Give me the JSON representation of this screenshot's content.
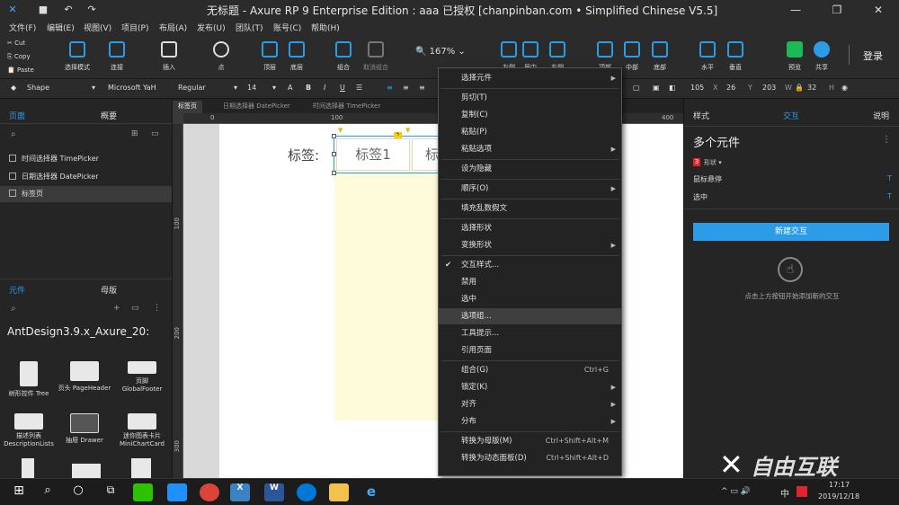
{
  "title": "无标题 - Axure RP 9 Enterprise Edition : aaa 已授权   [chanpinban.com • Simplified Chinese V5.5]",
  "window_controls": [
    "—",
    "❐",
    "✕"
  ],
  "menu": [
    "文件(F)",
    "编辑(E)",
    "视图(V)",
    "项目(P)",
    "布局(A)",
    "发布(U)",
    "团队(T)",
    "账号(C)",
    "帮助(H)"
  ],
  "clipboard": {
    "cut": "Cut",
    "copy": "Copy",
    "paste": "Paste"
  },
  "toolbar": {
    "select_mode": "选择模式",
    "connect": "连接",
    "insert": "插入",
    "point": "点",
    "top": "顶层",
    "bottom": "底层",
    "group": "组合",
    "ungroup": "取消组合",
    "zoom": "167%",
    "left": "左侧",
    "center": "居中",
    "right": "右侧",
    "top_align": "顶部",
    "middle": "中部",
    "bottom_align": "底部",
    "horizontal": "水平",
    "vertical": "垂直",
    "preview": "预览",
    "share": "共享",
    "login": "登录"
  },
  "format": {
    "shape": "Shape",
    "font": "Microsoft YaH",
    "weight": "Regular",
    "size": "14",
    "x": "105",
    "x_label": "X",
    "y": "26",
    "y_label": "Y",
    "w": "203",
    "w_label": "W",
    "h": "32",
    "h_label": "H"
  },
  "left_panel": {
    "tab_pages": "页面",
    "tab_outline": "概要",
    "pages": [
      "时间选择器 TimePicker",
      "日期选择器 DatePicker",
      "标签页"
    ],
    "tab_widgets": "元件",
    "tab_masters": "母版",
    "library": "AntDesign3.9.x_Axure_20:",
    "library_items": [
      {
        "name": "树形控件 Tree"
      },
      {
        "name": "页头 PageHeader"
      },
      {
        "name": "页脚 GlobalFooter"
      },
      {
        "name": "描述列表 DescriptionLists"
      },
      {
        "name": "抽屉 Drawer"
      },
      {
        "name": "迷你图表卡片 MiniChartCard"
      }
    ]
  },
  "doc_tabs": [
    "标签页",
    "日期选择器 DatePicker",
    "时间选择器 TimePicker"
  ],
  "ruler_h": [
    "0",
    "100",
    "400"
  ],
  "ruler_v": [
    "100",
    "200",
    "300"
  ],
  "canvas": {
    "label": "标签:",
    "tab1": "标签1",
    "tab2": "标"
  },
  "context_menu": [
    {
      "label": "选择元件",
      "arrow": "▶"
    },
    {
      "sep": true
    },
    {
      "label": "剪切(T)"
    },
    {
      "label": "复制(C)"
    },
    {
      "label": "粘贴(P)"
    },
    {
      "label": "粘贴选项",
      "arrow": "▶"
    },
    {
      "sep": true
    },
    {
      "label": "设为隐藏"
    },
    {
      "sep": true
    },
    {
      "label": "顺序(O)",
      "arrow": "▶"
    },
    {
      "sep": true
    },
    {
      "label": "填充乱数假文"
    },
    {
      "sep": true
    },
    {
      "label": "选择形状"
    },
    {
      "label": "变换形状",
      "arrow": "▶"
    },
    {
      "sep": true
    },
    {
      "label": "交互样式...",
      "check": "✔"
    },
    {
      "label": "禁用"
    },
    {
      "label": "选中"
    },
    {
      "label": "选项组...",
      "highlight": true
    },
    {
      "label": "工具提示..."
    },
    {
      "label": "引用页面"
    },
    {
      "sep": true
    },
    {
      "label": "组合(G)",
      "shortcut": "Ctrl+G"
    },
    {
      "label": "锁定(K)",
      "arrow": "▶"
    },
    {
      "label": "对齐",
      "arrow": "▶"
    },
    {
      "label": "分布",
      "arrow": "▶"
    },
    {
      "sep": true
    },
    {
      "label": "转换为母版(M)",
      "shortcut": "Ctrl+Shift+Alt+M"
    },
    {
      "label": "转换为动态面板(D)",
      "shortcut": "Ctrl+Shift+Alt+D"
    }
  ],
  "right_panel": {
    "tab_style": "样式",
    "tab_interaction": "交互",
    "tab_notes": "说明",
    "heading": "多个元件",
    "badge": "3",
    "shape": "形状 ▾",
    "event1": "鼠标悬停",
    "event2": "选中",
    "button": "新建交互",
    "hint": "点击上方按钮开始添加新的交互"
  },
  "taskbar": {
    "time": "17:17",
    "date": "2019/12/18",
    "ime": "中"
  },
  "watermark": "自由互联",
  "colors": {
    "accent": "#2d9ce6",
    "highlight_menu": "#3f3f3f",
    "canvas_yellow": "#fdfbd9"
  }
}
